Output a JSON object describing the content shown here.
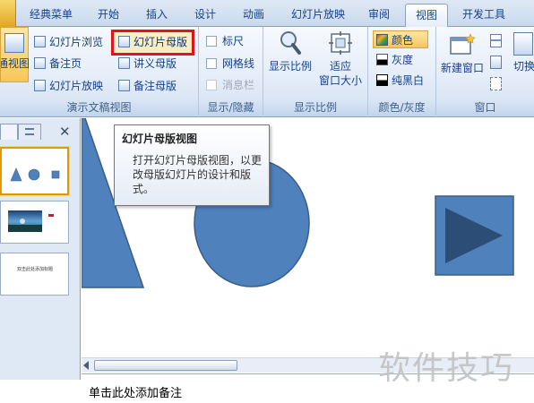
{
  "tabs": [
    {
      "label": "经典菜单",
      "active": false
    },
    {
      "label": "开始",
      "active": false
    },
    {
      "label": "插入",
      "active": false
    },
    {
      "label": "设计",
      "active": false
    },
    {
      "label": "动画",
      "active": false
    },
    {
      "label": "幻灯片放映",
      "active": false
    },
    {
      "label": "审阅",
      "active": false
    },
    {
      "label": "视图",
      "active": true
    },
    {
      "label": "开发工具",
      "active": false
    }
  ],
  "ribbon": {
    "presentation_views": {
      "normal_label": "普通视图",
      "slide_sorter": "幻灯片浏览",
      "notes_page": "备注页",
      "slide_show": "幻灯片放映",
      "slide_master": "幻灯片母版",
      "handout_master": "讲义母版",
      "notes_master": "备注母版",
      "group_label": "演示文稿视图"
    },
    "show_hide": {
      "ruler": "标尺",
      "gridlines": "网格线",
      "message_bar": "消息栏",
      "group_label": "显示/隐藏"
    },
    "zoom": {
      "zoom_label": "显示比例",
      "fit_label_1": "适应",
      "fit_label_2": "窗口大小",
      "group_label": "显示比例"
    },
    "color": {
      "color": "颜色",
      "grayscale": "灰度",
      "pure_bw": "纯黑白",
      "group_label": "颜色/灰度"
    },
    "window": {
      "new_window": "新建窗口",
      "switch_label": "切换",
      "group_label": "窗口"
    }
  },
  "slide_panel": {
    "thumb3_text": "双击此处添加标题"
  },
  "tooltip": {
    "title": "幻灯片母版视图",
    "body": "打开幻灯片母版视图，以更改母版幻灯片的设计和版式。"
  },
  "notes_placeholder": "单击此处添加备注",
  "watermark": "软件技巧",
  "colors": {
    "shape_fill": "#4f81bd",
    "shape_stroke": "#385d8a",
    "highlight": "#e0141e"
  }
}
